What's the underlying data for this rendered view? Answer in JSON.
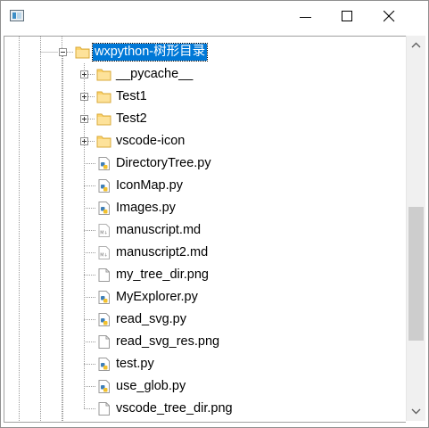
{
  "window": {
    "icon": "app-window-icon",
    "controls": [
      "minimize-icon",
      "maximize-icon",
      "close-icon"
    ]
  },
  "tree": {
    "items": [
      {
        "label": "wxpython-树形目录",
        "type": "folder",
        "expander": "minus",
        "selected": true
      },
      {
        "label": "__pycache__",
        "type": "folder",
        "expander": "plus"
      },
      {
        "label": "Test1",
        "type": "folder",
        "expander": "plus"
      },
      {
        "label": "Test2",
        "type": "folder",
        "expander": "plus"
      },
      {
        "label": "vscode-icon",
        "type": "folder",
        "expander": "plus"
      },
      {
        "label": "DirectoryTree.py",
        "type": "python"
      },
      {
        "label": "IconMap.py",
        "type": "python"
      },
      {
        "label": "Images.py",
        "type": "python"
      },
      {
        "label": "manuscript.md",
        "type": "markdown"
      },
      {
        "label": "manuscript2.md",
        "type": "markdown"
      },
      {
        "label": "my_tree_dir.png",
        "type": "file"
      },
      {
        "label": "MyExplorer.py",
        "type": "python"
      },
      {
        "label": "read_svg.py",
        "type": "python"
      },
      {
        "label": "read_svg_res.png",
        "type": "file"
      },
      {
        "label": "test.py",
        "type": "python"
      },
      {
        "label": "use_glob.py",
        "type": "python"
      },
      {
        "label": "vscode_tree_dir.png",
        "type": "file"
      }
    ]
  },
  "scrollbar": {
    "position": 0.56
  },
  "colors": {
    "selection": "#0078d7",
    "folder": "#fcd36b",
    "python": "#3f7fb7"
  }
}
